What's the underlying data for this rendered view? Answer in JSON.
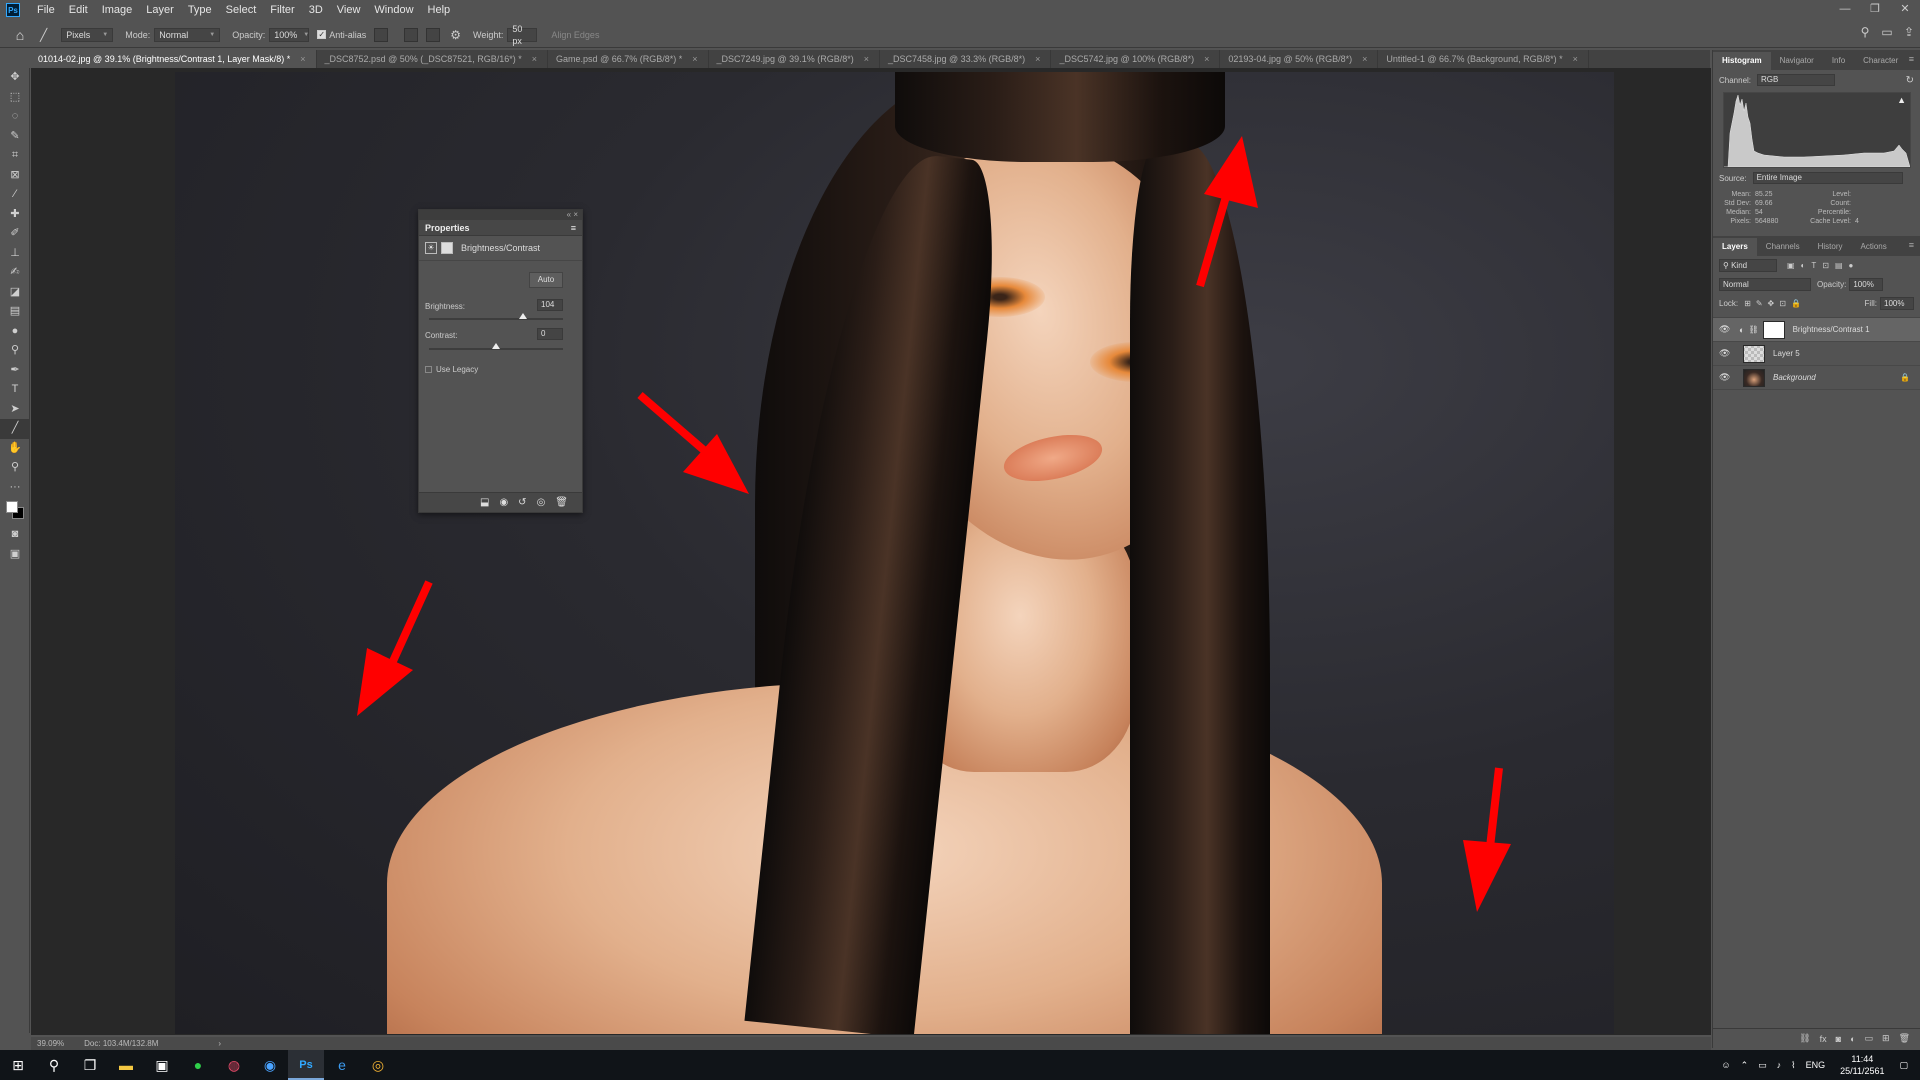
{
  "app": {
    "logo": "Ps",
    "menu": [
      "File",
      "Edit",
      "Image",
      "Layer",
      "Type",
      "Select",
      "Filter",
      "3D",
      "View",
      "Window",
      "Help"
    ],
    "window_controls": [
      "—",
      "❐",
      "✕"
    ]
  },
  "options": {
    "tool_mode": "Pixels",
    "mode_label": "Mode:",
    "mode_value": "Normal",
    "opacity_label": "Opacity:",
    "opacity_value": "100%",
    "antialias_label": "Anti-alias",
    "weight_label": "Weight:",
    "weight_value": "50 px",
    "align_edges": "Align Edges"
  },
  "tabs": [
    {
      "label": "01014-02.jpg @ 39.1% (Brightness/Contrast 1, Layer Mask/8) *",
      "active": true
    },
    {
      "label": "_DSC8752.psd @ 50% (_DSC87521, RGB/16*) *"
    },
    {
      "label": "Game.psd @ 66.7% (RGB/8*) *"
    },
    {
      "label": "_DSC7249.jpg @ 39.1% (RGB/8*)"
    },
    {
      "label": "_DSC7458.jpg @ 33.3% (RGB/8*)"
    },
    {
      "label": "_DSC5742.jpg @ 100% (RGB/8*)"
    },
    {
      "label": "02193-04.jpg @ 50% (RGB/8*)"
    },
    {
      "label": "Untitled-1 @ 66.7% (Background, RGB/8*) *"
    }
  ],
  "properties": {
    "panel_title": "Properties",
    "adjustment": "Brightness/Contrast",
    "auto_label": "Auto",
    "brightness_label": "Brightness:",
    "brightness_value": "104",
    "brightness_fraction": 0.7,
    "contrast_label": "Contrast:",
    "contrast_value": "0",
    "contrast_fraction": 0.5,
    "legacy_label": "Use Legacy"
  },
  "status": {
    "zoom": "39.09%",
    "doc": "Doc: 103.4M/132.8M"
  },
  "histogram_panel": {
    "tabs": [
      "Histogram",
      "Navigator",
      "Info",
      "Character"
    ],
    "channel_label": "Channel:",
    "channel_value": "RGB",
    "source_label": "Source:",
    "source_value": "Entire Image",
    "stats": [
      {
        "k": "Mean:",
        "v": "85.25",
        "k2": "Level:",
        "v2": ""
      },
      {
        "k": "Std Dev:",
        "v": "69.66",
        "k2": "Count:",
        "v2": ""
      },
      {
        "k": "Median:",
        "v": "54",
        "k2": "Percentile:",
        "v2": ""
      },
      {
        "k": "Pixels:",
        "v": "564880",
        "k2": "Cache Level:",
        "v2": "4"
      }
    ]
  },
  "layers_panel": {
    "tabs": [
      "Layers",
      "Channels",
      "History",
      "Actions"
    ],
    "kind_label": "Kind",
    "blend_mode": "Normal",
    "opacity_label": "Opacity:",
    "opacity_value": "100%",
    "lock_label": "Lock:",
    "fill_label": "Fill:",
    "fill_value": "100%",
    "layers": [
      {
        "name": "Brightness/Contrast 1",
        "selected": true
      },
      {
        "name": "Layer 5"
      },
      {
        "name": "Background"
      }
    ]
  },
  "taskbar": {
    "lang": "ENG",
    "time": "11:44",
    "date": "25/11/2561"
  }
}
